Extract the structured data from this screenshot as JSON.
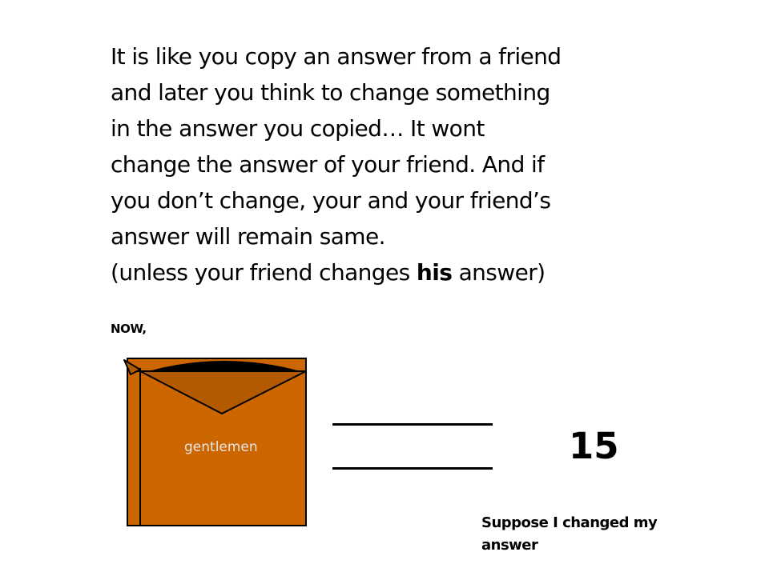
{
  "paragraph": {
    "line1": "It is like you copy an answer from a friend",
    "line2": "and later you think to change something",
    "line3": "in the answer you copied… It wont",
    "line4": "change the answer of your friend.  And if",
    "line5": "you don’t change, your and your friend’s",
    "line6": "answer will remain same.",
    "line7_pre": "(unless your friend changes ",
    "line7_bold": "his",
    "line7_post": " answer)"
  },
  "now_label": "NOW,",
  "box": {
    "label": "gentlemen",
    "fill_color": "#cc6600",
    "flap_color": "#b35900"
  },
  "number_value": "15",
  "caption": {
    "line1": "Suppose I changed my",
    "line2": "answer"
  }
}
